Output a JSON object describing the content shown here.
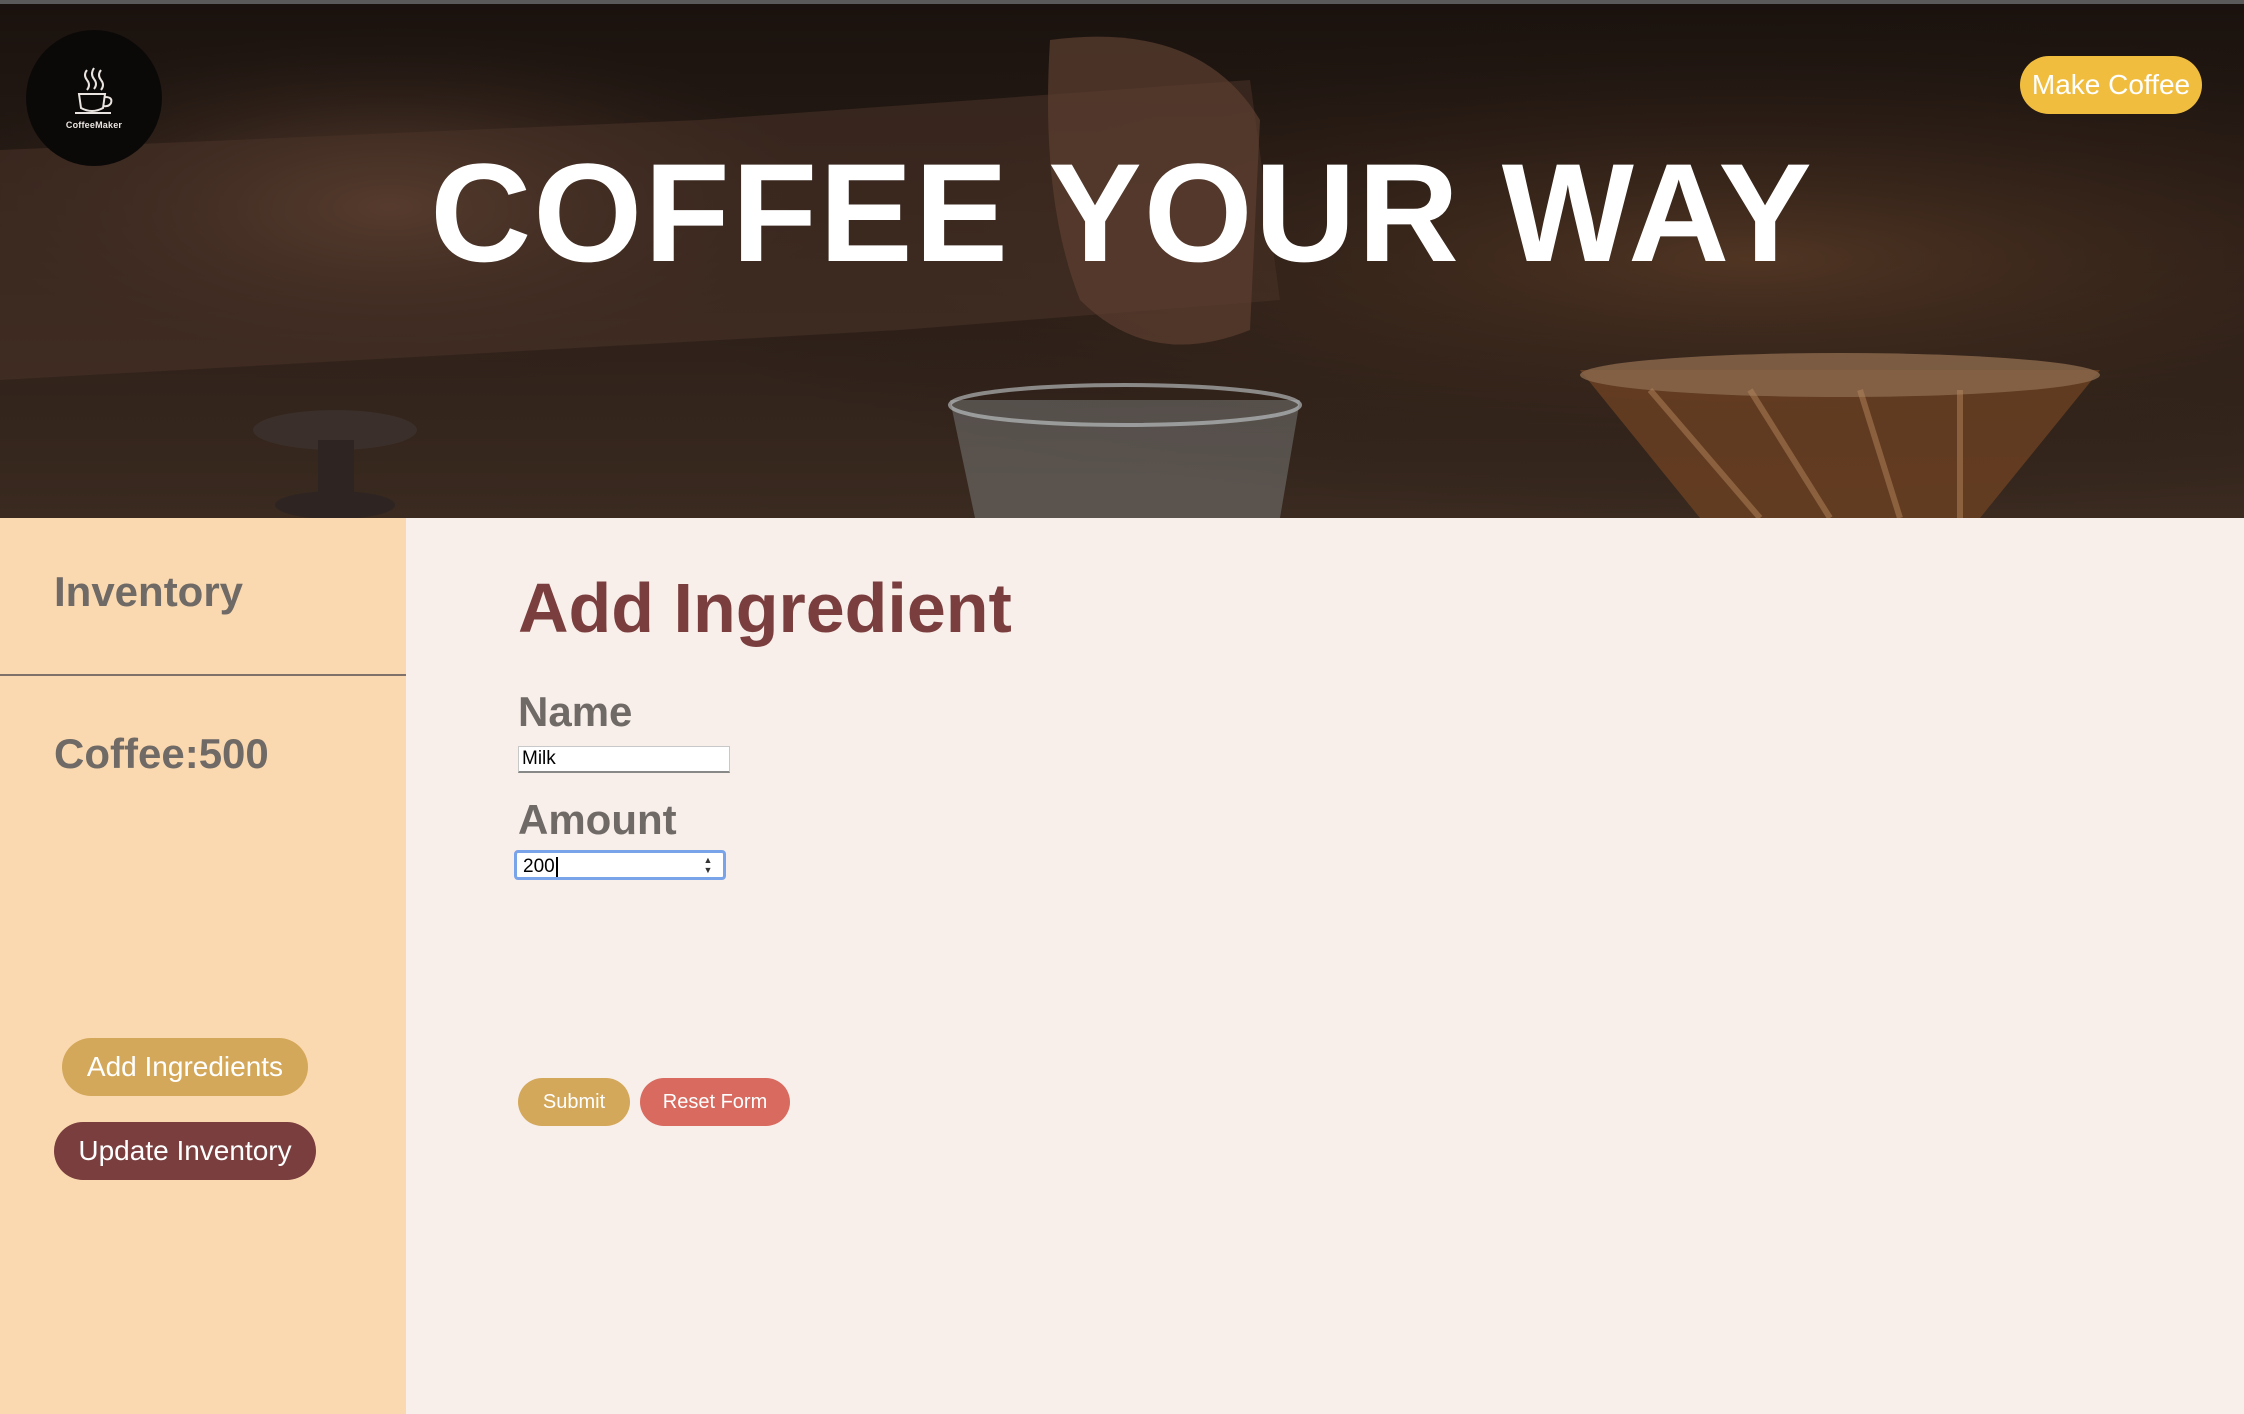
{
  "header": {
    "logo_text": "CoffeeMaker",
    "make_coffee_label": "Make Coffee",
    "hero_title": "COFFEE YOUR WAY"
  },
  "sidebar": {
    "heading": "Inventory",
    "coffee_name": "Coffee",
    "coffee_amount": "500",
    "add_ingredients_label": "Add Ingredients",
    "update_inventory_label": "Update Inventory"
  },
  "form": {
    "title": "Add Ingredient",
    "name_label": "Name",
    "name_value": "Milk",
    "amount_label": "Amount",
    "amount_value": "200",
    "submit_label": "Submit",
    "reset_label": "Reset Form"
  },
  "colors": {
    "accent_yellow": "#f0bd3e",
    "sidebar_bg": "#fbd9b0",
    "main_bg": "#f8eeea",
    "title_brown": "#7a3e3e",
    "submit_gold": "#d4a85a",
    "reset_red": "#d86a5f"
  }
}
